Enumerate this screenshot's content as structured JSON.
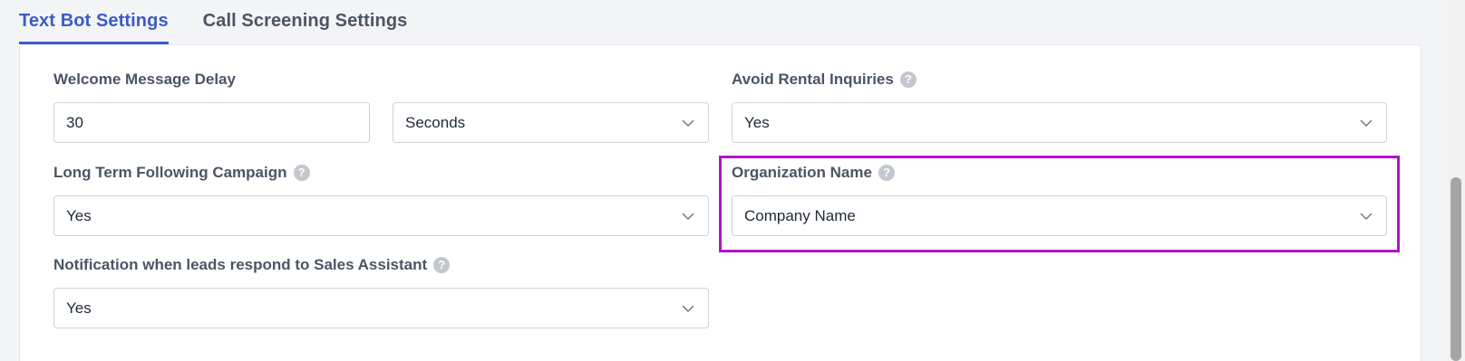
{
  "tabs": [
    {
      "label": "Text Bot Settings",
      "active": true
    },
    {
      "label": "Call Screening Settings",
      "active": false
    }
  ],
  "fields": {
    "welcome_delay": {
      "label": "Welcome Message Delay",
      "value": "30",
      "unit": "Seconds"
    },
    "avoid_rental": {
      "label": "Avoid Rental Inquiries",
      "value": "Yes"
    },
    "long_term": {
      "label": "Long Term Following Campaign",
      "value": "Yes"
    },
    "org_name": {
      "label": "Organization Name",
      "value": "Company Name"
    },
    "notification": {
      "label": "Notification when leads respond to Sales Assistant",
      "value": "Yes"
    }
  },
  "icons": {
    "help": "?",
    "help_name": "question-circle-icon",
    "chevron_name": "chevron-down-icon"
  },
  "colors": {
    "accent": "#3b5bc6",
    "highlight": "#b313c9",
    "help_icon": "#c3c7ce"
  }
}
